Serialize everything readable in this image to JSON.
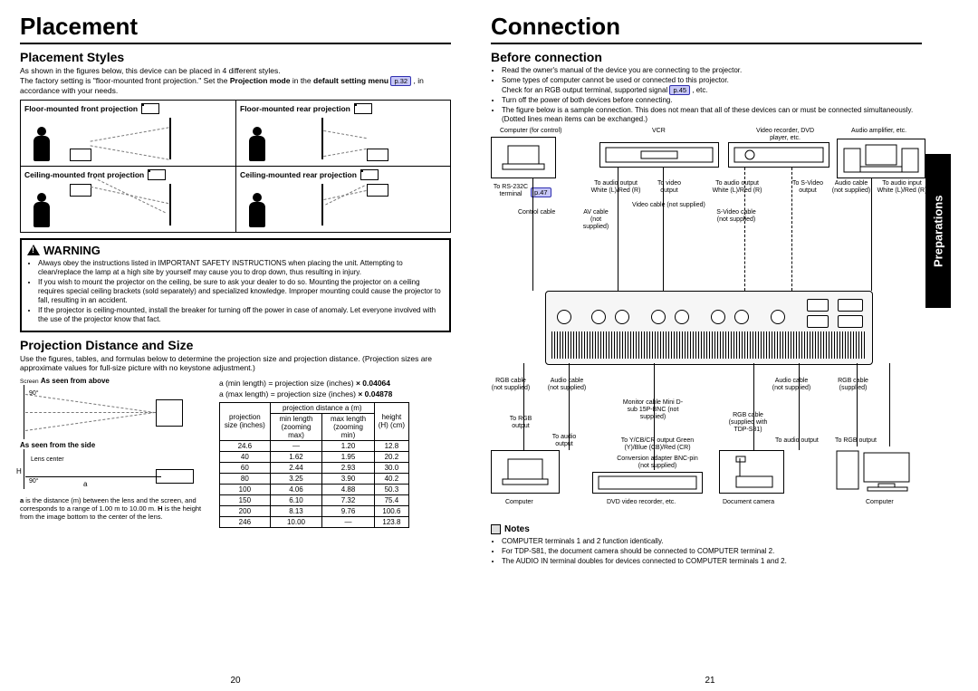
{
  "left": {
    "title": "Placement",
    "styles_hdr": "Placement Styles",
    "styles_intro1": "As shown in the figures below, this device can be placed in 4 different styles.",
    "styles_intro2_a": "The factory setting is \"floor-mounted front projection.\" Set the ",
    "styles_intro2_b": "Projection mode",
    "styles_intro2_c": " in the ",
    "styles_intro2_d": "default setting menu ",
    "pref32": "p.32",
    "styles_intro2_e": " , in accordance with your needs.",
    "tiles": [
      "Floor-mounted front projection",
      "Floor-mounted rear projection",
      "Ceiling-mounted front projection",
      "Ceiling-mounted rear projection"
    ],
    "warn_hdr": "WARNING",
    "warn_items": [
      "Always obey the instructions listed in IMPORTANT SAFETY INSTRUCTIONS when placing the unit. Attempting to clean/replace the lamp at a high site by yourself may cause you to drop down, thus resulting in injury.",
      "If you wish to mount the projector on the ceiling, be sure to ask your dealer to do so. Mounting the projector on a ceiling requires special ceiling brackets (sold separately) and specialized knowledge. Improper mounting could cause the projector to fall, resulting in an accident.",
      "If the projector is ceiling-mounted, install the breaker for turning off the power in case of anomaly. Let everyone involved with the use of the projector know that fact."
    ],
    "dist_hdr": "Projection Distance and Size",
    "dist_p1": "Use the figures, tables, and formulas below to determine the projection size and projection distance. (Projection sizes are approximate values for full-size picture with no keystone adjustment.)",
    "screen_lbl": "Screen",
    "above": "As seen from above",
    "side": "As seen from the side",
    "lenscenter": "Lens center",
    "ninety": "90°",
    "H": "H",
    "a": "a",
    "formula_min_a": "a (min length) = projection size (inches) ",
    "formula_min_b": "× 0.04064",
    "formula_max_a": "a (max length) = projection size (inches) ",
    "formula_max_b": "× 0.04878",
    "caption_a": "a is the distance (m) between the lens and the screen, and corresponds to a range of 1.00 m to 10.00 m. H is the height from the image bottom to the center of the lens.",
    "table": {
      "hdr_size": "projection\nsize (inches)",
      "hdr_dist": "projection distance a (m)",
      "hdr_min": "min length\n(zooming max)",
      "hdr_max": "max length\n(zooming min)",
      "hdr_h": "height (H)\n(cm)",
      "rows": [
        [
          "24.6",
          "—",
          "1.20",
          "12.8"
        ],
        [
          "40",
          "1.62",
          "1.95",
          "20.2"
        ],
        [
          "60",
          "2.44",
          "2.93",
          "30.0"
        ],
        [
          "80",
          "3.25",
          "3.90",
          "40.2"
        ],
        [
          "100",
          "4.06",
          "4.88",
          "50.3"
        ],
        [
          "150",
          "6.10",
          "7.32",
          "75.4"
        ],
        [
          "200",
          "8.13",
          "9.76",
          "100.6"
        ],
        [
          "246",
          "10.00",
          "—",
          "123.8"
        ]
      ]
    },
    "pageno": "20"
  },
  "right": {
    "title": "Connection",
    "before_hdr": "Before connection",
    "bullets": [
      "Read the owner's manual of the device you are connecting to the projector.",
      "Some types of computer cannot be used or connected to this projector.",
      "Turn off the power of both devices before connecting.",
      "The figure below is a sample connection. This does not mean that all of these devices can or must be connected simultaneously. (Dotted lines mean items can be exchanged.)"
    ],
    "check_a": "Check for an RGB output terminal, supported signal ",
    "pref45": "p.45",
    "check_b": " , etc.",
    "pref47": "p.47",
    "devices": {
      "computer_control": "Computer (for control)",
      "vcr": "VCR",
      "recorder": "Video recorder,\nDVD player, etc.",
      "amp": "Audio amplifier, etc.",
      "rs232": "To RS-232C\nterminal",
      "ctrl_cable": "Control cable",
      "avcable": "AV cable\n(not supplied)",
      "audioout": "To audio output\nWhite (L)/Red (R)",
      "videoout": "To video\noutput",
      "videocable": "Video cable (not supplied)",
      "svideocable": "S-Video cable\n(not supplied)",
      "svideoout": "To S-Video\noutput",
      "audiocable_ns": "Audio cable\n(not supplied)",
      "audioin": "To audio input\nWhite (L)/Red (R)",
      "rgbcable_ns": "RGB cable\n(not supplied)",
      "audiocable2": "Audio cable\n(not supplied)",
      "rgbcable_sup": "RGB cable\n(supplied)",
      "monitor_cable": "Monitor cable Mini\nD-sub 15P-BNC\n(not supplied)",
      "rgb_s81": "RGB cable\n(supplied with\nTDP-S81)",
      "torgb": "To RGB\noutput",
      "toaudioout2": "To audio\noutput",
      "toaudioout3": "To audio output",
      "torgbout2": "To RGB output",
      "convadapter": "Conversion adapter BNC-pin\n(not supplied)",
      "ycbcr": "To Y/CB/CR output\nGreen (Y)/Blue (CB)/Red (CR)",
      "computer": "Computer",
      "dvdrec": "DVD video recorder, etc.",
      "doccam": "Document camera",
      "computer2": "Computer"
    },
    "notes_hdr": "Notes",
    "notes": [
      "COMPUTER terminals 1 and 2 function identically.",
      "For TDP-S81, the document camera should be connected to COMPUTER terminal 2.",
      "The AUDIO IN terminal doubles for devices connected to COMPUTER terminals 1 and 2."
    ],
    "sidetab": "Preparations",
    "pageno": "21"
  }
}
